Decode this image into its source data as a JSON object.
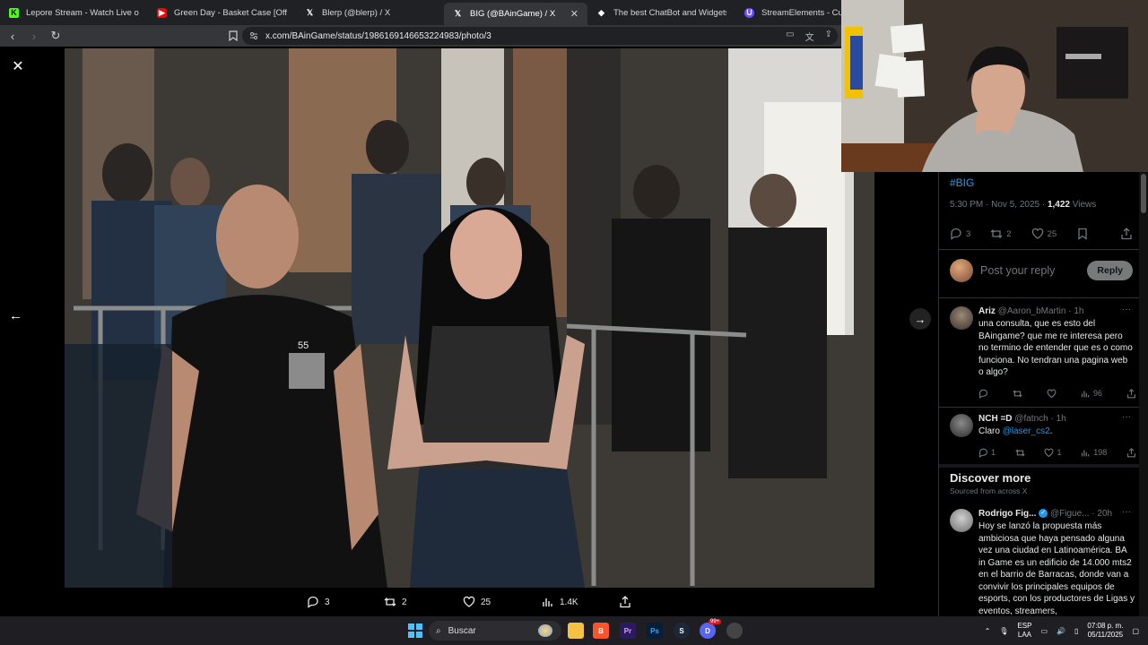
{
  "browser": {
    "tabs": [
      {
        "title": "Lepore Stream - Watch Live on Kick",
        "favicon": "kick-icon",
        "color": "#53fc18",
        "active": false
      },
      {
        "title": "Green Day - Basket Case [Official Mu",
        "favicon": "youtube-icon",
        "color": "#ff0000",
        "active": false
      },
      {
        "title": "Blerp (@blerp) / X",
        "favicon": "x-icon",
        "color": "#ffffff",
        "active": false
      },
      {
        "title": "BIG (@BAinGame) / X",
        "favicon": "x-icon",
        "color": "#ffffff",
        "active": true
      },
      {
        "title": "The best ChatBot and Widgets for Ki",
        "favicon": "diamond-icon",
        "color": "#ffffff",
        "active": false
      },
      {
        "title": "StreamElements - Custom",
        "favicon": "streamelements-icon",
        "color": "#6b4cff",
        "active": false
      }
    ],
    "url": "x.com/BAinGame/status/1986169146653224983/photo/3"
  },
  "photo_actions": {
    "replies": "3",
    "reposts": "2",
    "likes": "25",
    "views": "1.4K"
  },
  "right_pane": {
    "hashtag": "#BIG",
    "time": "5:30 PM",
    "date": "Nov 5, 2025",
    "views_count": "1,422",
    "views_label": "Views",
    "stats": {
      "replies": "3",
      "reposts": "2",
      "likes": "25"
    },
    "reply_placeholder": "Post your reply",
    "reply_button": "Reply",
    "replies": [
      {
        "name": "Ariz",
        "handle": "@Aaron_bMartin",
        "age": "1h",
        "text": "una consulta, que es esto del BAingame? que me re interesa pero no termino de entender que es o como funciona. No tendran una pagina web o algo?",
        "views": "96",
        "likes": "",
        "replies": ""
      },
      {
        "name": "NCH =D",
        "handle": "@fatnch",
        "age": "1h",
        "text_prefix": "Claro ",
        "mention": "@laser_cs2",
        "text_suffix": ".",
        "replies": "1",
        "likes": "1",
        "views": "198"
      }
    ],
    "discover_title": "Discover more",
    "discover_sub": "Sourced from across X",
    "discover_tweet": {
      "name": "Rodrigo Fig...",
      "handle": "@Figue...",
      "age": "20h",
      "text": "Hoy se lanzó la propuesta más ambiciosa que haya pensado alguna vez una ciudad en Latinoamérica. BA in Game es un edificio de 14.000 mts2 en el barrio de Barracas, donde van a convivir los principales equipos de esports, con los productores de Ligas y eventos, streamers,"
    }
  },
  "taskbar": {
    "search": "Buscar",
    "lang_top": "ESP",
    "lang_bottom": "LAA",
    "time": "07:08 p. m.",
    "date": "05/11/2025",
    "badge": "99+"
  },
  "photo_shirt_text": "55"
}
